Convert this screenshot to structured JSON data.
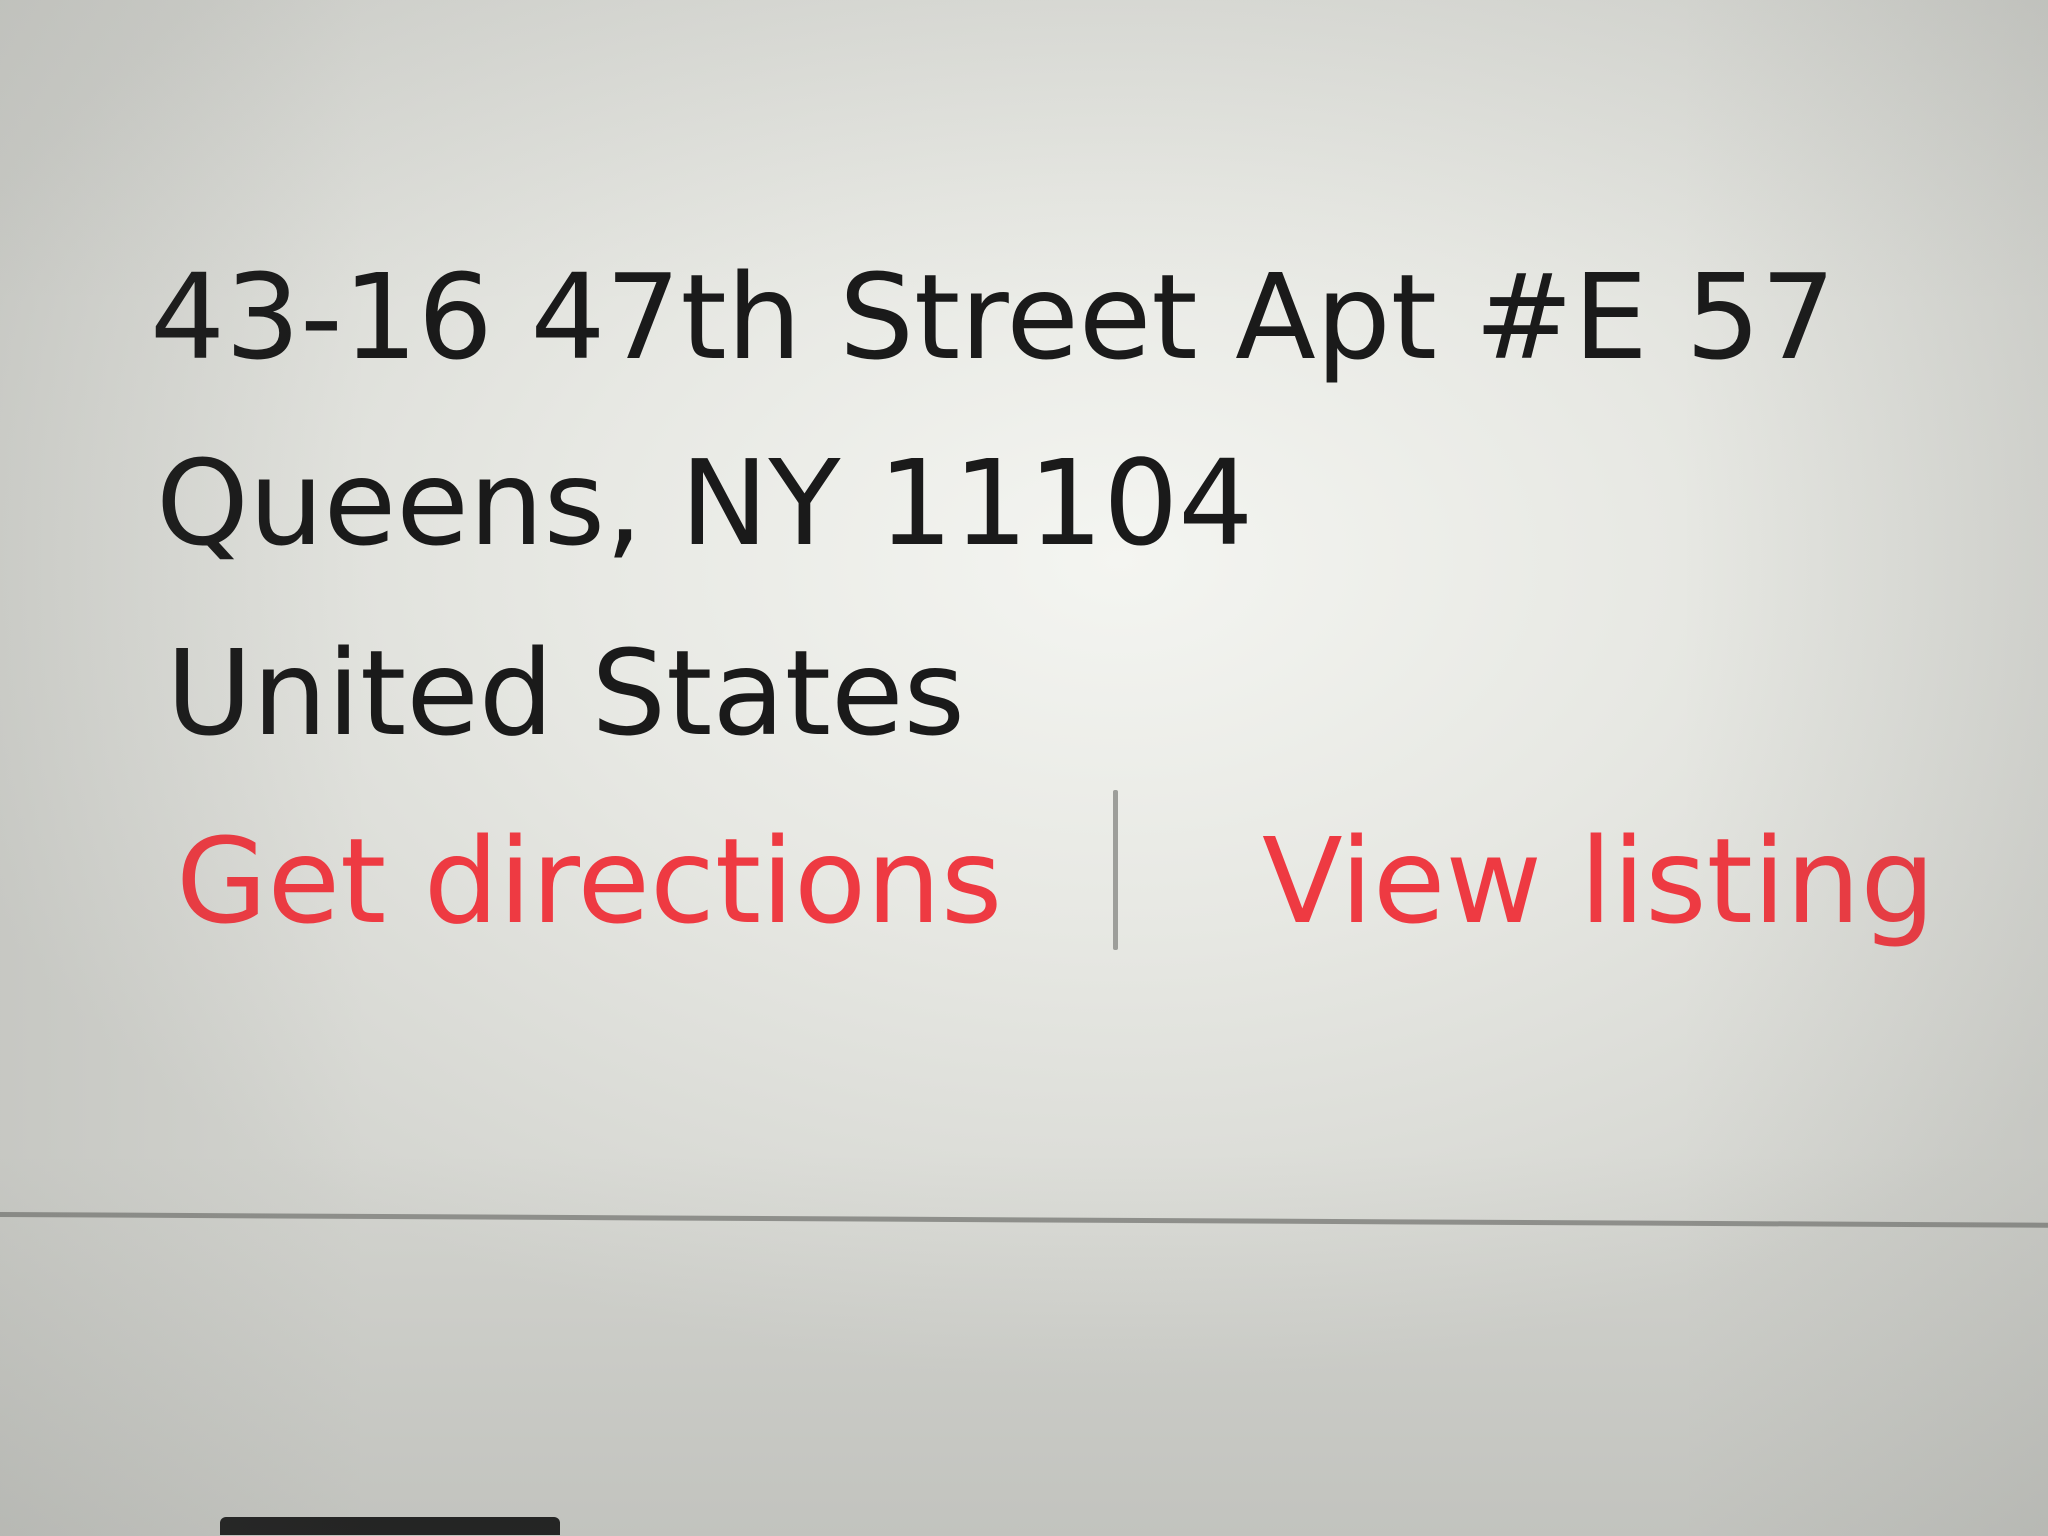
{
  "address": {
    "line1": "43-16 47th Street Apt #E 57",
    "line2": "Queens, NY 11104",
    "line3": "United States"
  },
  "actions": {
    "get_directions_label": "Get directions",
    "view_listing_label": "View listing"
  },
  "colors": {
    "link": "#ee3a42",
    "text": "#1a1a1a",
    "divider": "#9d9e9a",
    "background": "#f4f5f1"
  }
}
